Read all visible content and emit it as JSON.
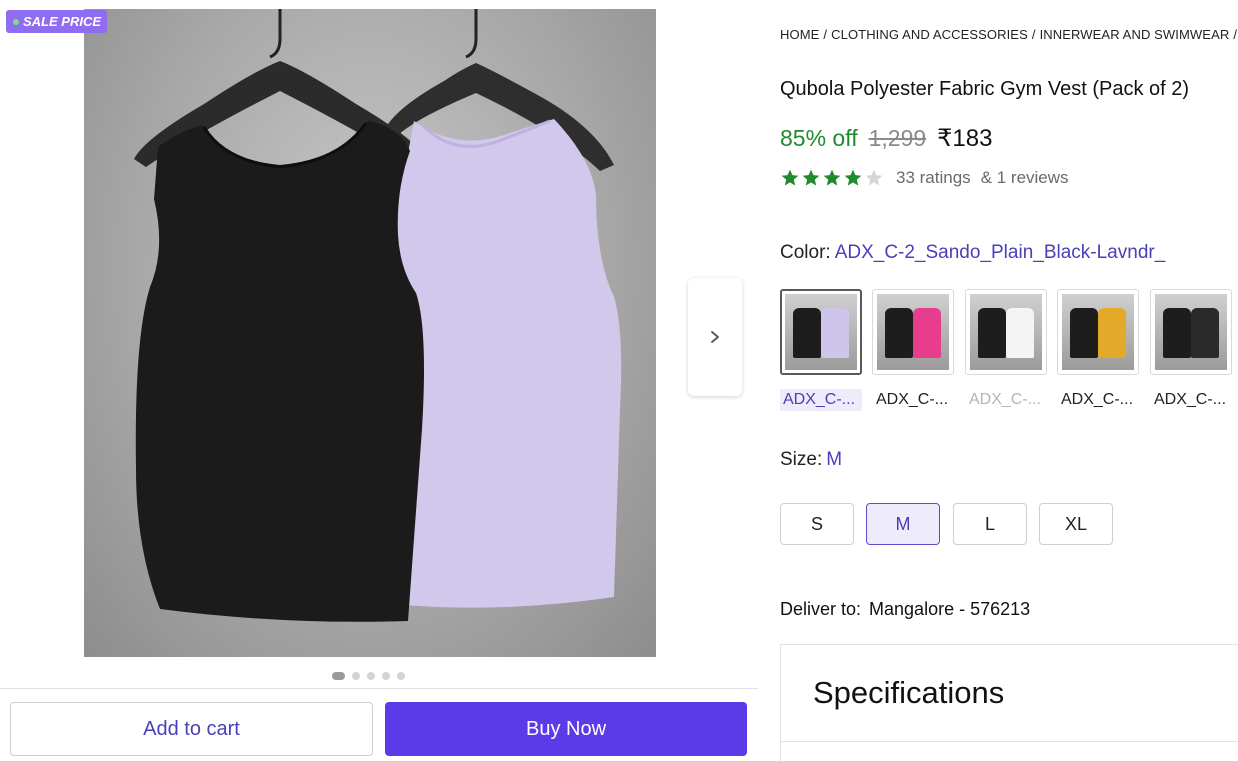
{
  "badge": {
    "label": "SALE PRICE"
  },
  "gallery": {
    "dot_count": 5,
    "active_dot": 0,
    "next_icon": "chevron-right-icon"
  },
  "actions": {
    "add_to_cart": "Add to cart",
    "buy_now": "Buy Now"
  },
  "breadcrumb": [
    "HOME",
    "CLOTHING AND ACCESSORIES",
    "INNERWEAR AND SWIMWEAR"
  ],
  "breadcrumb_separator": "/",
  "product": {
    "title": "Qubola Polyester Fabric Gym Vest (Pack of 2)",
    "discount": "85% off",
    "mrp": "1,299",
    "price": "₹183",
    "rating": 4,
    "max_rating": 5,
    "ratings_count": "33 ratings",
    "reviews_count": "& 1 reviews"
  },
  "color": {
    "label": "Color:",
    "selected_value": "ADX_C-2_Sando_Plain_Black-Lavndr_",
    "options": [
      {
        "label": "ADX_C-...",
        "selected": true,
        "disabled": false,
        "colors": [
          "#1d1d1d",
          "#cfc5ea"
        ]
      },
      {
        "label": "ADX_C-...",
        "selected": false,
        "disabled": false,
        "colors": [
          "#1d1d1d",
          "#e83d8c"
        ]
      },
      {
        "label": "ADX_C-...",
        "selected": false,
        "disabled": true,
        "colors": [
          "#1d1d1d",
          "#f4f4f4"
        ]
      },
      {
        "label": "ADX_C-...",
        "selected": false,
        "disabled": false,
        "colors": [
          "#1d1d1d",
          "#e3a928"
        ]
      },
      {
        "label": "ADX_C-...",
        "selected": false,
        "disabled": false,
        "colors": [
          "#1d1d1d",
          "#2a2a2a"
        ]
      }
    ]
  },
  "size": {
    "label": "Size:",
    "selected_value": "M",
    "options": [
      "S",
      "M",
      "L",
      "XL"
    ]
  },
  "delivery": {
    "label": "Deliver to:",
    "location": "Mangalore - 576213"
  },
  "specifications": {
    "title": "Specifications"
  },
  "colors": {
    "accent": "#5b3be8",
    "accent_text": "#4a3fb8",
    "discount": "#1f8a2e",
    "star": "#1f8a2e",
    "badge": "#8f6cf0"
  }
}
